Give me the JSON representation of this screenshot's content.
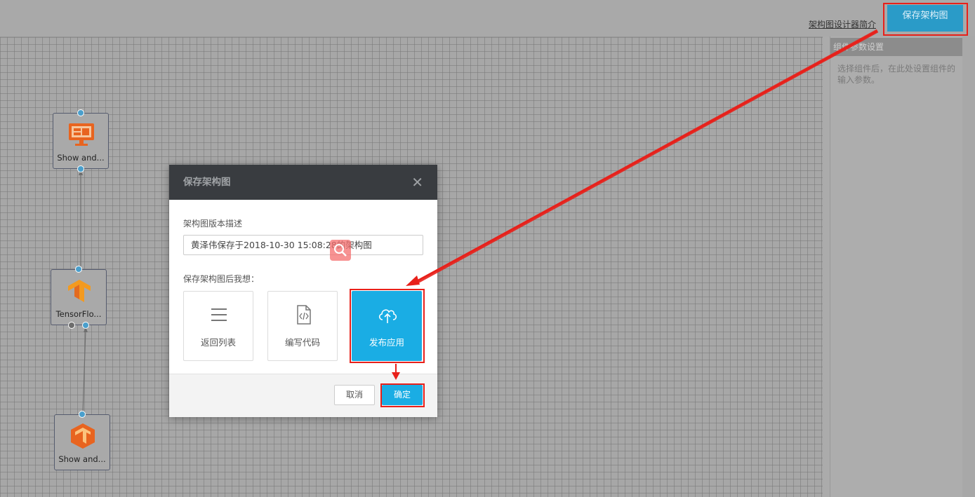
{
  "header": {
    "intro_link": "架构图设计器简介",
    "save_button": "保存架构图"
  },
  "panel": {
    "title": "组件参数设置",
    "hint": "选择组件后，在此处设置组件的输入参数。"
  },
  "nodes": [
    {
      "label": "Show and...",
      "icon": "monitor-icon"
    },
    {
      "label": "TensorFlo...",
      "icon": "tensorflow-icon"
    },
    {
      "label": "Show and...",
      "icon": "tensorflow-hex-icon"
    }
  ],
  "dialog": {
    "title": "保存架构图",
    "desc_label": "架构图版本描述",
    "desc_value": "黄泽伟保存于2018-10-30 15:08:28的架构图",
    "after_label": "保存架构图后我想：",
    "options": [
      {
        "label": "返回列表",
        "icon": "list-icon",
        "selected": false
      },
      {
        "label": "编写代码",
        "icon": "code-file-icon",
        "selected": false
      },
      {
        "label": "发布应用",
        "icon": "cloud-upload-icon",
        "selected": true
      }
    ],
    "cancel_label": "取消",
    "ok_label": "确定"
  },
  "colors": {
    "accent": "#1aade4",
    "highlight": "#e8201a",
    "dialog_header": "#393c40"
  }
}
